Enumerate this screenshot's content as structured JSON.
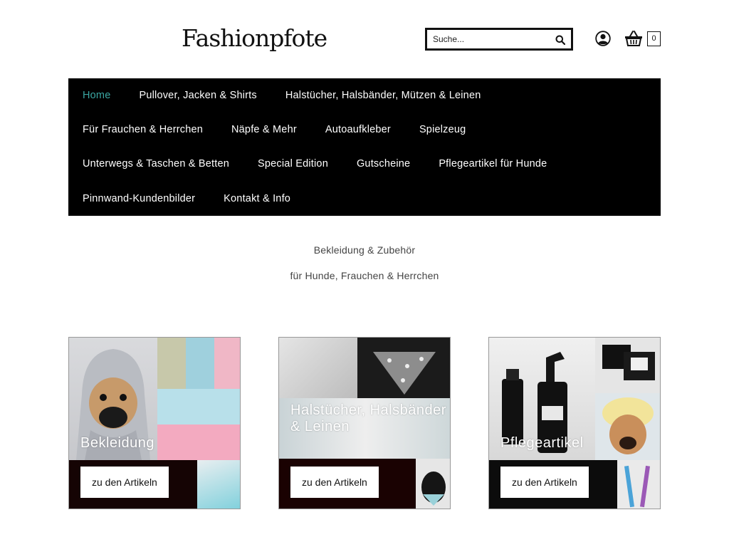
{
  "header": {
    "logo": "Fashionpfote",
    "search_placeholder": "Suche...",
    "cart_count": "0"
  },
  "nav": {
    "rows": [
      [
        "Home",
        "Pullover, Jacken & Shirts",
        "Halstücher, Halsbänder, Mützen & Leinen"
      ],
      [
        "Für Frauchen & Herrchen",
        "Näpfe & Mehr",
        "Autoaufkleber",
        "Spielzeug"
      ],
      [
        "Unterwegs & Taschen & Betten",
        "Special Edition",
        "Gutscheine",
        "Pflegeartikel für Hunde"
      ],
      [
        "Pinnwand-Kundenbilder",
        "Kontakt & Info"
      ]
    ]
  },
  "intro": {
    "line1": "Bekleidung & Zubehör",
    "line2": "für Hunde, Frauchen & Herrchen"
  },
  "cards": [
    {
      "title": "Bekleidung",
      "button": "zu den Artikeln"
    },
    {
      "title": "Halstücher, Halsbänder & Leinen",
      "button": "zu den Artikeln"
    },
    {
      "title": "Pflegeartikel",
      "button": "zu den Artikeln"
    }
  ],
  "colors": {
    "nav_bg": "#000000",
    "nav_active": "#3aa7a3",
    "nav_text": "#ffffff"
  }
}
